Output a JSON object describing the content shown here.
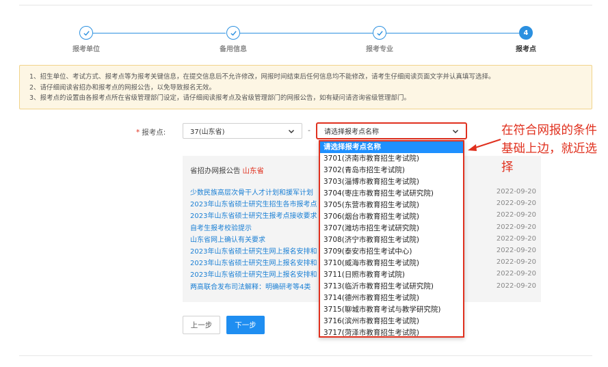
{
  "stepper": {
    "steps": [
      {
        "label": "报考单位",
        "done": true
      },
      {
        "label": "备用信息",
        "done": true
      },
      {
        "label": "报考专业",
        "done": true
      },
      {
        "label": "报考点",
        "done": false,
        "number": "4"
      }
    ]
  },
  "notice": {
    "lines": [
      "1、招生单位、考试方式、报考点等为报考关键信息，在提交信息后不允许修改，网报时间结束后任何信息均不能修改，请考生仔细阅读页面文字并认真填写选择。",
      "2、请仔细阅读省招办和报考点的网报公告，以免导致报名无效。",
      "3、报考点的设置由各报考点所在省级管理部门设定，请仔细阅读报考点及省级管理部门的网报公告，如有疑问请咨询省级管理部门。"
    ]
  },
  "form": {
    "required_mark": "*",
    "label": "报考点:",
    "province_value": "37(山东省)",
    "separator": "-",
    "site_value": "请选择报考点名称"
  },
  "announcements": {
    "header": "省招办网报公告",
    "province": "山东省",
    "items": [
      {
        "title": "少数民族高层次骨干人才计划和援军计划",
        "date": "2022-09-20"
      },
      {
        "title": "2023年山东省硕士研究生招生各市报考点",
        "date": "2022-09-20"
      },
      {
        "title": "2023年山东省硕士研究生报考点接收要求",
        "date": "2022-09-20"
      },
      {
        "title": "自考生报考校验提示",
        "date": "2022-09-20"
      },
      {
        "title": "山东省网上确认有关要求",
        "date": "2022-09-20"
      },
      {
        "title": "2023年山东省硕士研究生网上报名安排和",
        "date": "2022-09-20"
      },
      {
        "title": "2023年山东省硕士研究生网上报名安排和",
        "date": "2022-09-20"
      },
      {
        "title": "2023年山东省硕士研究生网上报名安排和",
        "date": "2022-09-20"
      },
      {
        "title": "两高联合发布司法解释：明确研考等4类",
        "date": "2022-09-20"
      }
    ]
  },
  "buttons": {
    "prev": "上一步",
    "next": "下一步"
  },
  "dropdown": {
    "options": [
      "请选择报考点名称",
      "3701(济南市教育招生考试院)",
      "3702(青岛市招生考试院)",
      "3703(淄博市教育招生考试院)",
      "3704(枣庄市教育招生考试研究院)",
      "3705(东营市教育招生考试院)",
      "3706(烟台市教育招生考试院)",
      "3707(潍坊市招生考试研究院)",
      "3708(济宁市教育招生考试院)",
      "3709(泰安市招生考试中心)",
      "3710(威海市教育招生考试院)",
      "3711(日照市教育考试院)",
      "3713(临沂市教育招生考试研究院)",
      "3714(德州市教育招生考试院)",
      "3715(聊城市教育考试与教学研究院)",
      "3716(滨州市教育招生考试院)",
      "3717(菏泽市教育招生考试院)"
    ],
    "selected_index": 0
  },
  "annotation": {
    "text": "在符合网报的条件基础上边，就近选择",
    "color": "#e0301e"
  },
  "colors": {
    "accent": "#2b90e0",
    "primary_button": "#1f8ef1",
    "highlight": "#e0301e"
  }
}
